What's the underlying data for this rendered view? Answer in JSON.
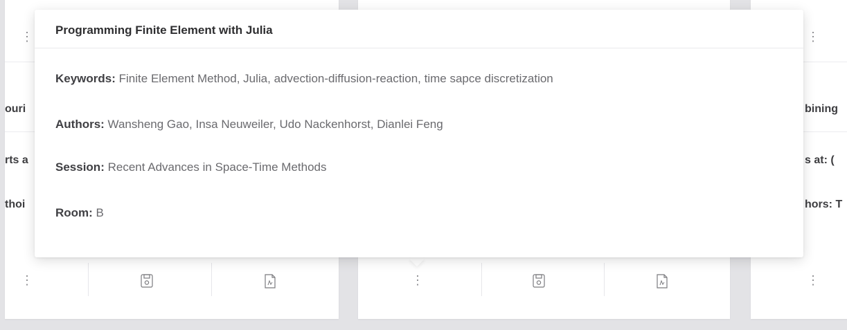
{
  "cards": {
    "left": {
      "title_fragment": "ouri",
      "starts_fragment": "rts a",
      "authors_fragment": "thoi"
    },
    "right": {
      "title_fragment": "bining",
      "starts_fragment": "s at: (",
      "authors_fragment": "hors: T"
    }
  },
  "popover": {
    "title": "Programming Finite Element with Julia",
    "keywords_label": "Keywords:",
    "keywords_value": " Finite Element Method, Julia, advection-diffusion-reaction, time sapce discretization",
    "authors_label": "Authors:",
    "authors_value": " Wansheng Gao, Insa Neuweiler, Udo Nackenhorst, Dianlei Feng",
    "session_label": "Session:",
    "session_value": " Recent Advances in Space-Time Methods",
    "room_label": "Room:",
    "room_value": " B"
  },
  "icons": {
    "more": "more-vertical-icon",
    "save": "save-icon",
    "pdf": "pdf-icon"
  },
  "colors": {
    "background": "#e3e3e6",
    "card": "#ffffff",
    "text": "#6a6a6e",
    "label": "#3f3f43"
  }
}
